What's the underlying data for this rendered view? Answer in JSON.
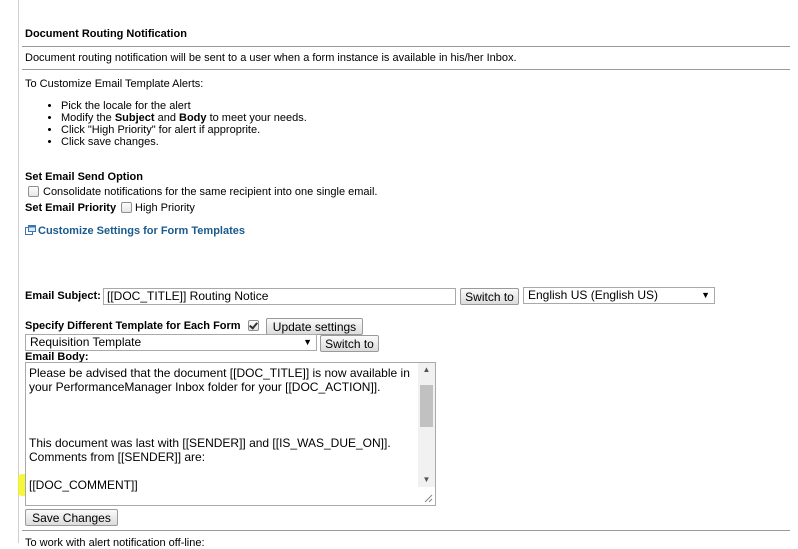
{
  "section": {
    "title": "Document Routing Notification",
    "description": "Document routing notification will be sent to a user when a form instance is available in his/her Inbox."
  },
  "customize": {
    "heading": "To Customize Email Template Alerts:",
    "steps": [
      {
        "text": "Pick the locale for the alert"
      },
      {
        "pre": "Modify the ",
        "b1": "Subject",
        "mid": " and ",
        "b2": "Body",
        "post": " to meet your needs."
      },
      {
        "text": "Click \"High Priority\" for alert if approprite."
      },
      {
        "text": "Click save changes."
      }
    ]
  },
  "send_option": {
    "heading": "Set Email Send Option",
    "consolidate_label": "Consolidate notifications for the same recipient into one single email.",
    "consolidate_checked": false
  },
  "priority": {
    "heading": "Set Email Priority",
    "high_priority_label": "High Priority",
    "high_priority_checked": false
  },
  "form_templates_link": "Customize Settings for Form Templates",
  "subject": {
    "label": "Email Subject:",
    "value": "[[DOC_TITLE]] Routing Notice",
    "switch_button": "Switch to",
    "locale_selected": "English US (English US)"
  },
  "template": {
    "label": "Specify Different Template for Each Form",
    "checked": true,
    "update_button": "Update settings",
    "selected": "Requisition Template",
    "switch_button": "Switch to"
  },
  "body": {
    "label": "Email Body:",
    "line1": "Please be advised that the document [[DOC_TITLE]] is now available in your PerformanceManager Inbox folder for your [[DOC_ACTION]].",
    "line2": "This document was last with [[SENDER]] and [[IS_WAS_DUE_ON]].",
    "line3": "Comments from [[SENDER]] are:",
    "line4": "[[DOC_COMMENT]]"
  },
  "save_button": "Save Changes",
  "footer_partial": "To work with alert notification off-line:"
}
